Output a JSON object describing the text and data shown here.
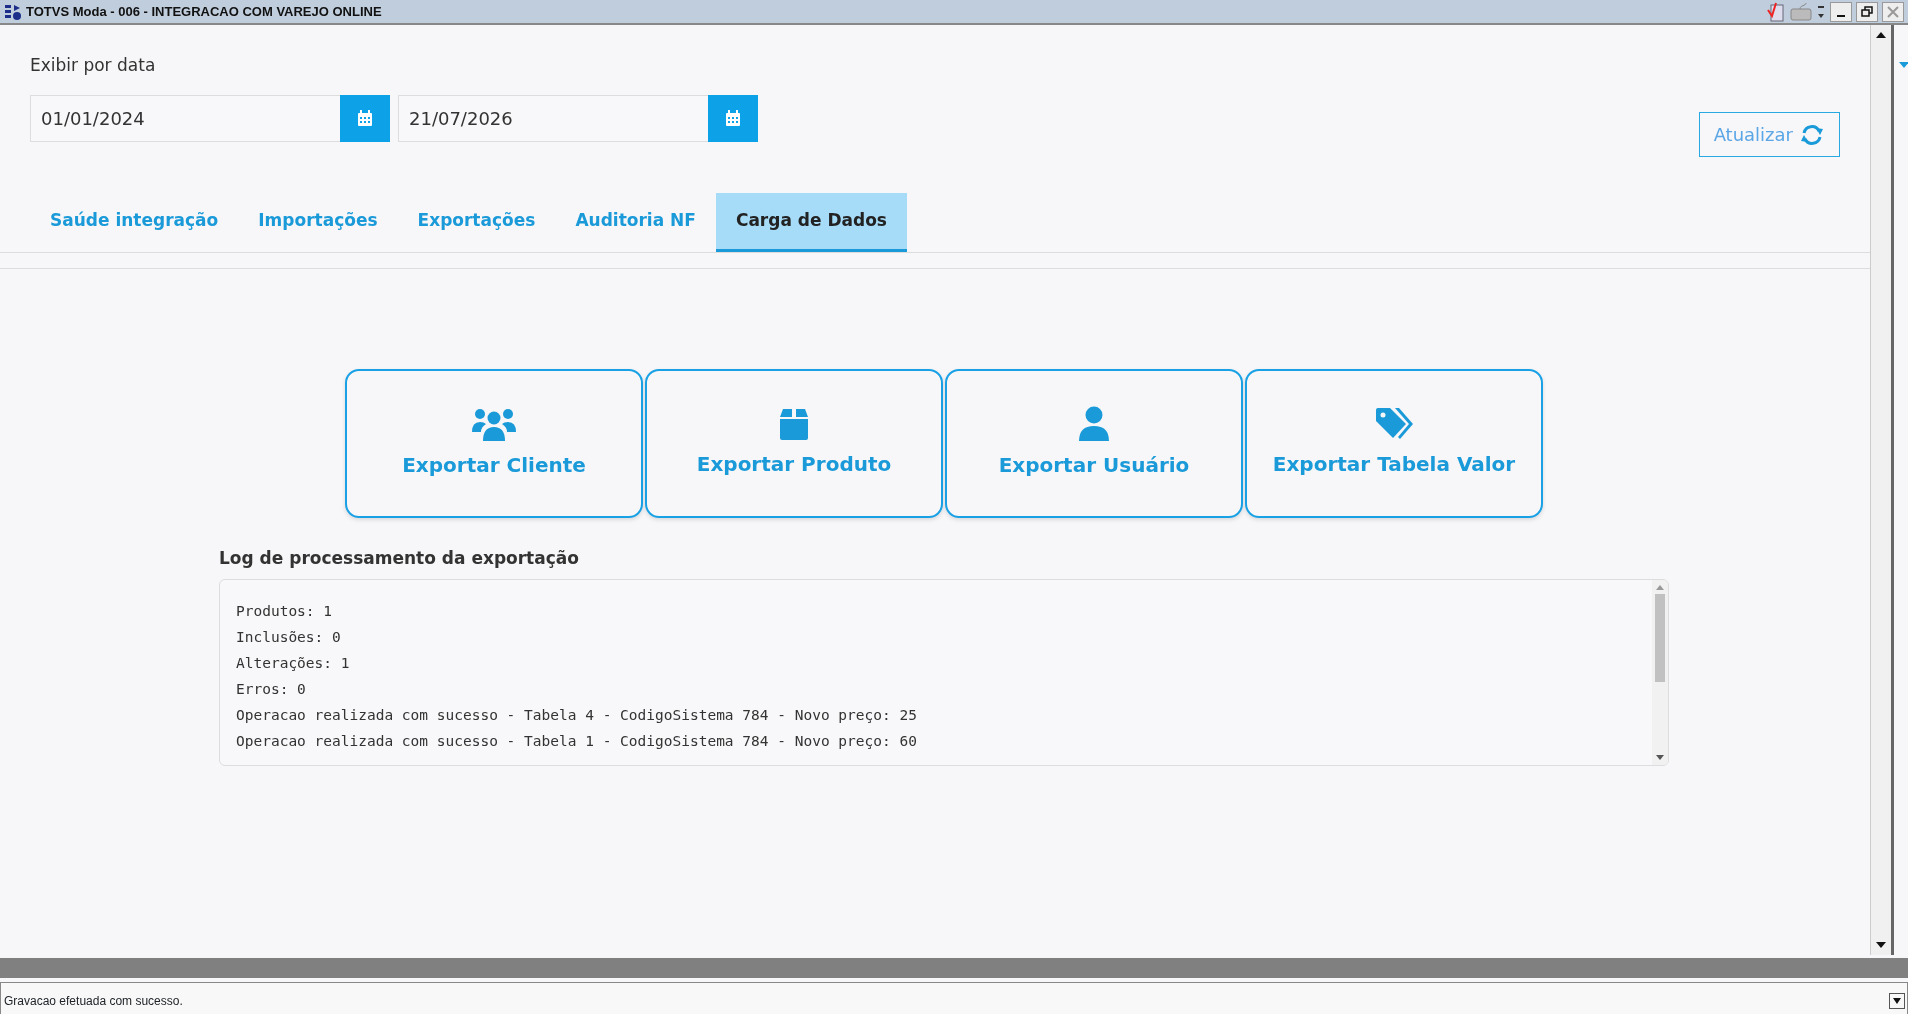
{
  "window": {
    "title": "TOTVS Moda - 006 - INTEGRACAO COM VAREJO ONLINE"
  },
  "date_filter": {
    "label": "Exibir por data",
    "start": "01/01/2024",
    "end": "21/07/2026"
  },
  "refresh_button": {
    "label": "Atualizar"
  },
  "tabs": [
    {
      "label": "Saúde integração",
      "selected": false
    },
    {
      "label": "Importações",
      "selected": false
    },
    {
      "label": "Exportações",
      "selected": false
    },
    {
      "label": "Auditoria NF",
      "selected": false
    },
    {
      "label": "Carga de Dados",
      "selected": true
    }
  ],
  "export_buttons": [
    {
      "label": "Exportar Cliente",
      "kind": "users"
    },
    {
      "label": "Exportar Produto",
      "kind": "box"
    },
    {
      "label": "Exportar Usuário",
      "kind": "user"
    },
    {
      "label": "Exportar Tabela Valor",
      "kind": "tags"
    }
  ],
  "log": {
    "title": "Log de processamento da exportação",
    "lines": [
      "Produtos: 1",
      "Inclusões: 0",
      "Alterações: 1",
      "Erros: 0",
      "Operacao realizada com sucesso - Tabela 4 - CodigoSistema 784 - Novo preço: 25",
      "Operacao realizada com sucesso - Tabela 1 - CodigoSistema 784 - Novo preço: 60"
    ]
  },
  "status_bar": {
    "message": "Gravacao efetuada com sucesso."
  }
}
